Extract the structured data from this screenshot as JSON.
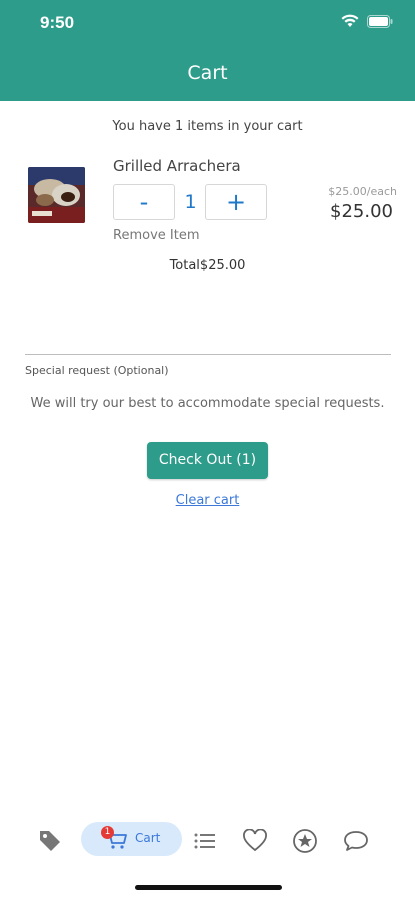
{
  "status": {
    "time": "9:50"
  },
  "header": {
    "title": "Cart"
  },
  "cart": {
    "summary": "You have 1 items in your cart",
    "item": {
      "name": "Grilled Arrachera",
      "quantity": "1",
      "minus_label": "-",
      "plus_label": "+",
      "remove_label": "Remove Item",
      "unit_price": "$25.00/each",
      "line_price": "$25.00"
    },
    "total": "Total$25.00"
  },
  "special_request": {
    "label": "Special request (Optional)",
    "hint": "We will try our best to accommodate special requests."
  },
  "actions": {
    "checkout": "Check Out (1)",
    "clear": "Clear cart"
  },
  "tabbar": {
    "cart_label": "Cart",
    "cart_badge": "1",
    "icons": [
      "tag-icon",
      "cart-icon",
      "list-icon",
      "heart-icon",
      "star-icon",
      "chat-icon"
    ]
  },
  "colors": {
    "brand": "#2e9c8a",
    "link": "#3b78d8",
    "badge": "#e53935"
  }
}
